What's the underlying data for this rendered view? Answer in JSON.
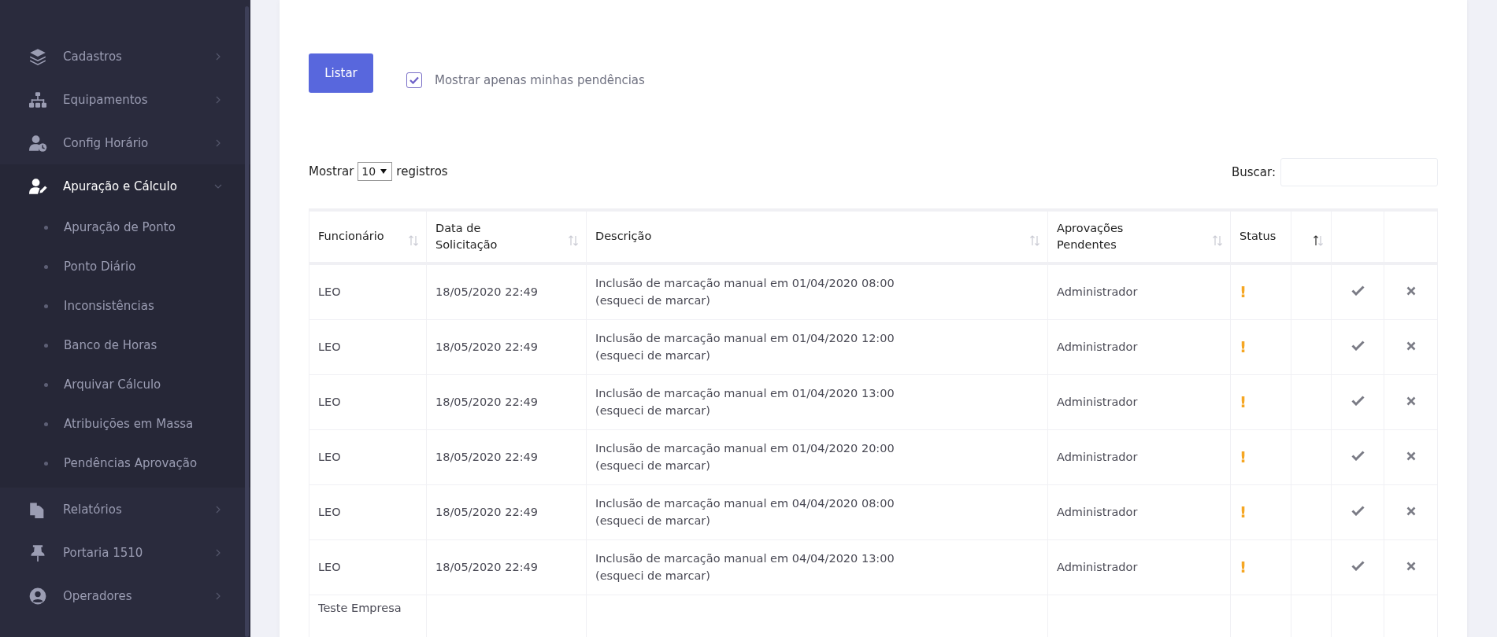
{
  "sidebar": {
    "items": [
      {
        "label": "Cadastros",
        "expanded": false
      },
      {
        "label": "Equipamentos",
        "expanded": false
      },
      {
        "label": "Config Horário",
        "expanded": false
      },
      {
        "label": "Apuração e Cálculo",
        "expanded": true,
        "children": [
          {
            "label": "Apuração de Ponto"
          },
          {
            "label": "Ponto Diário"
          },
          {
            "label": "Inconsistências"
          },
          {
            "label": "Banco de Horas"
          },
          {
            "label": "Arquivar Cálculo"
          },
          {
            "label": "Atribuições em Massa"
          },
          {
            "label": "Pendências Aprovação"
          }
        ]
      },
      {
        "label": "Relatórios",
        "expanded": false
      },
      {
        "label": "Portaria 1510",
        "expanded": false
      },
      {
        "label": "Operadores",
        "expanded": false
      }
    ]
  },
  "toolbar": {
    "button": "Listar",
    "checkbox": {
      "label": "Mostrar apenas minhas pendências",
      "checked": true
    }
  },
  "length_control": {
    "before": "Mostrar",
    "value": "10",
    "after": "registros"
  },
  "search": {
    "label": "Buscar:"
  },
  "table": {
    "columns": [
      {
        "label": "Funcionário",
        "sorted": false
      },
      {
        "label": "Data de Solicitação",
        "sorted": false
      },
      {
        "label": "Descrição",
        "sorted": false
      },
      {
        "label": "Aprovações Pendentes",
        "sorted": false
      },
      {
        "label": "Status"
      },
      {
        "sorted": true
      },
      {},
      {}
    ],
    "rows": [
      {
        "employee": "LEO",
        "date": "18/05/2020 22:49",
        "description": "Inclusão de marcação manual em 01/04/2020 08:00 (esqueci de marcar)",
        "approvers": "Administrador",
        "status": "!"
      },
      {
        "employee": "LEO",
        "date": "18/05/2020 22:49",
        "description": "Inclusão de marcação manual em 01/04/2020 12:00 (esqueci de marcar)",
        "approvers": "Administrador",
        "status": "!"
      },
      {
        "employee": "LEO",
        "date": "18/05/2020 22:49",
        "description": "Inclusão de marcação manual em 01/04/2020 13:00 (esqueci de marcar)",
        "approvers": "Administrador",
        "status": "!"
      },
      {
        "employee": "LEO",
        "date": "18/05/2020 22:49",
        "description": "Inclusão de marcação manual em 01/04/2020 20:00 (esqueci de marcar)",
        "approvers": "Administrador",
        "status": "!"
      },
      {
        "employee": "LEO",
        "date": "18/05/2020 22:49",
        "description": "Inclusão de marcação manual em 04/04/2020 08:00 (esqueci de marcar)",
        "approvers": "Administrador",
        "status": "!"
      },
      {
        "employee": "LEO",
        "date": "18/05/2020 22:49",
        "description": "Inclusão de marcação manual em 04/04/2020 13:00 (esqueci de marcar)",
        "approvers": "Administrador",
        "status": "!"
      },
      {
        "employee": "Teste Empresa"
      }
    ]
  }
}
